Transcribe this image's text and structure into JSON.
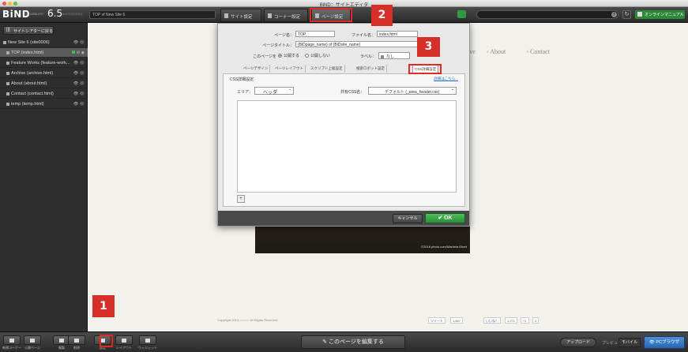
{
  "window": {
    "title": "BiND：サイトエディタ"
  },
  "topbar": {
    "logo": "BiND",
    "logo_sub": "FOR WEBLIFE*",
    "version": "6.5",
    "build": "ver.6.5.0(1/1024)",
    "page_path": "TOP of New Site 6",
    "tabs": [
      {
        "label": "サイト設定"
      },
      {
        "label": "コーナー設定"
      },
      {
        "label": "ページ設定"
      }
    ],
    "manual_label": "オンラインマニュアル",
    "icons": {
      "screen": "screen-icon",
      "info": "info-icon",
      "reload": "reload-icon"
    }
  },
  "sidebar": {
    "open_tree_label": "サイトシアターに戻る",
    "items": [
      {
        "label": "New Site 6 (site0006)"
      },
      {
        "label": "TOP (index.html)"
      },
      {
        "label": "Feature Works (feature-work..."
      },
      {
        "label": "Archive (archive.html)"
      },
      {
        "label": "About (about.html)"
      },
      {
        "label": "Contact (contact.html)"
      },
      {
        "label": "temp (temp.html)"
      }
    ]
  },
  "canvas": {
    "nav": [
      "ive",
      "About",
      "Contact"
    ],
    "hero_credit": "©2016 photo.com/Marketa Ebert",
    "footer": "Copyright 2013 ○○○○○ All Rights Reserved.",
    "social": {
      "tweet": "ツイート",
      "tweet_count": "1,847",
      "like": "いいね！",
      "like_count": "1,271",
      "plus": "+1",
      "plus_count": "4"
    }
  },
  "dialog": {
    "page_name_label": "ページ名：",
    "page_name_value": "TOP",
    "file_name_label": "ファイル名：",
    "file_name_value": "index.html",
    "page_title_label": "ページタイトル：",
    "page_title_value": "{BiDpage_name} of {BiDsite_name}",
    "publish_label": "このページを",
    "publish_options": [
      "公開する",
      "公開しない"
    ],
    "label_label": "ラベル：",
    "label_value": "なし",
    "subtabs": [
      "ページデザイン",
      "ページレイアウト",
      "スクリプト上級設定",
      "検索ロボット設定",
      "CSS詳細設定"
    ],
    "css": {
      "title": "CSS詳細設定",
      "detail_link": "詳細はこちら...",
      "area_label": "エリア：",
      "area_value": "ヘッダ",
      "common_css_label": "共有CSS名：",
      "common_css_value": "デフォルト (_area_header.css)",
      "add_label": "+"
    },
    "cancel_label": "キャンセル",
    "ok_label": "OK"
  },
  "bottombar": {
    "buttons": [
      {
        "label": "新規コーナー"
      },
      {
        "label": "公開ページ"
      },
      {
        "label": "複製"
      },
      {
        "label": "削除"
      },
      {
        "label": "設定"
      },
      {
        "label": "レイアウト"
      },
      {
        "label": "ウィジェット"
      }
    ],
    "edit_page_label": "このページを編集する",
    "upload_label": "アップロード",
    "preview_label": "プレビュー",
    "mobile_label": "モバイル",
    "pc_label": "PCブラウザ"
  },
  "callouts": [
    "1",
    "2",
    "3"
  ],
  "colors": {
    "callout": "#d62f2a",
    "ok_green": "#3aa84a",
    "accent_blue": "#2a6bd6"
  }
}
